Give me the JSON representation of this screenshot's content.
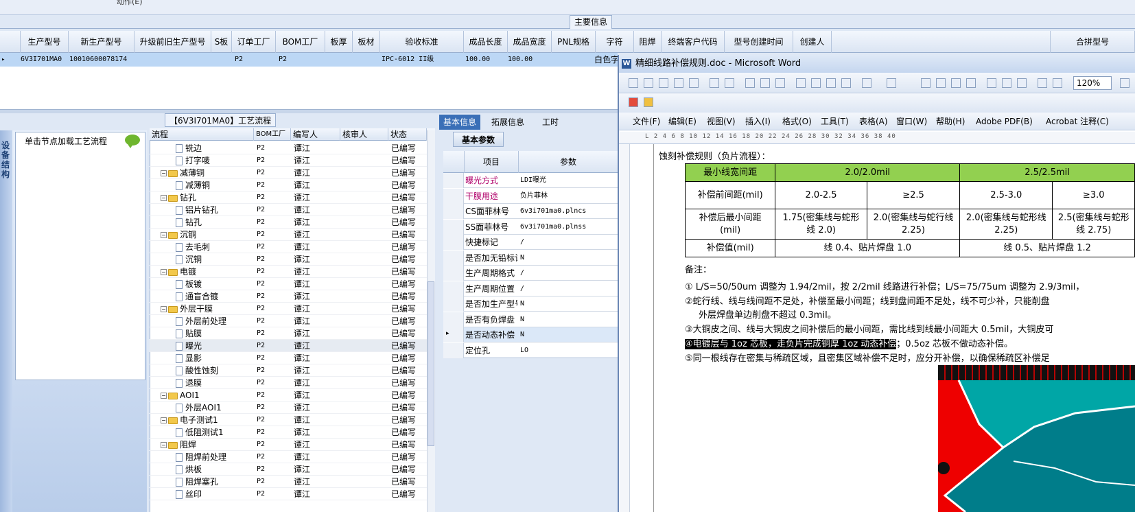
{
  "top": {
    "partial_text": "动作(E)",
    "main_info_label": "主要信息"
  },
  "grid": {
    "headers": [
      "生产型号",
      "新生产型号",
      "升级前旧生产型号",
      "S板",
      "订单工厂",
      "BOM工厂",
      "板厚",
      "板材",
      "验收标准",
      "成品长度",
      "成品宽度",
      "PNL规格",
      "字符",
      "阻焊",
      "终端客户代码",
      "型号创建时间",
      "创建人",
      "合拼型号"
    ],
    "row": {
      "prod_model": "6V3I701MA0",
      "new_model": "10010600078174",
      "order_factory": "P2",
      "bom_factory": "P2",
      "standard": "IPC-6012 II级",
      "length": "100.00",
      "width": "100.00",
      "char": "白色字"
    }
  },
  "left": {
    "vertical_label": "设备结构",
    "hint": "单击节点加载工艺流程"
  },
  "tree": {
    "title": "【6V3I701MA0】工艺流程",
    "headers": [
      "流程",
      "BOM工厂",
      "编写人",
      "核审人",
      "状态"
    ],
    "rows": [
      {
        "type": "doc",
        "name": "铣边",
        "bom": "P2",
        "author": "谭江",
        "reviewer": "",
        "status": "已编写"
      },
      {
        "type": "doc",
        "name": "打字唛",
        "bom": "P2",
        "author": "谭江",
        "reviewer": "",
        "status": "已编写"
      },
      {
        "type": "folder",
        "name": "减薄铜",
        "bom": "P2",
        "author": "谭江",
        "reviewer": "",
        "status": "已编写"
      },
      {
        "type": "doc",
        "name": "减薄铜",
        "bom": "P2",
        "author": "谭江",
        "reviewer": "",
        "status": "已编写"
      },
      {
        "type": "folder",
        "name": "钻孔",
        "bom": "P2",
        "author": "谭江",
        "reviewer": "",
        "status": "已编写"
      },
      {
        "type": "doc",
        "name": "铝片钻孔",
        "bom": "P2",
        "author": "谭江",
        "reviewer": "",
        "status": "已编写"
      },
      {
        "type": "doc",
        "name": "钻孔",
        "bom": "P2",
        "author": "谭江",
        "reviewer": "",
        "status": "已编写"
      },
      {
        "type": "folder",
        "name": "沉铜",
        "bom": "P2",
        "author": "谭江",
        "reviewer": "",
        "status": "已编写"
      },
      {
        "type": "doc",
        "name": "去毛刺",
        "bom": "P2",
        "author": "谭江",
        "reviewer": "",
        "status": "已编写"
      },
      {
        "type": "doc",
        "name": "沉铜",
        "bom": "P2",
        "author": "谭江",
        "reviewer": "",
        "status": "已编写"
      },
      {
        "type": "folder",
        "name": "电镀",
        "bom": "P2",
        "author": "谭江",
        "reviewer": "",
        "status": "已编写"
      },
      {
        "type": "doc",
        "name": "板镀",
        "bom": "P2",
        "author": "谭江",
        "reviewer": "",
        "status": "已编写"
      },
      {
        "type": "doc",
        "name": "通盲合镀",
        "bom": "P2",
        "author": "谭江",
        "reviewer": "",
        "status": "已编写"
      },
      {
        "type": "folder",
        "name": "外层干膜",
        "bom": "P2",
        "author": "谭江",
        "reviewer": "",
        "status": "已编写"
      },
      {
        "type": "doc",
        "name": "外层前处理",
        "bom": "P2",
        "author": "谭江",
        "reviewer": "",
        "status": "已编写"
      },
      {
        "type": "doc",
        "name": "贴膜",
        "bom": "P2",
        "author": "谭江",
        "reviewer": "",
        "status": "已编写"
      },
      {
        "type": "doc",
        "name": "曝光",
        "bom": "P2",
        "author": "谭江",
        "reviewer": "",
        "status": "已编写",
        "selected": true
      },
      {
        "type": "doc",
        "name": "显影",
        "bom": "P2",
        "author": "谭江",
        "reviewer": "",
        "status": "已编写"
      },
      {
        "type": "doc",
        "name": "酸性蚀刻",
        "bom": "P2",
        "author": "谭江",
        "reviewer": "",
        "status": "已编写"
      },
      {
        "type": "doc",
        "name": "退膜",
        "bom": "P2",
        "author": "谭江",
        "reviewer": "",
        "status": "已编写"
      },
      {
        "type": "folder",
        "name": "AOI1",
        "bom": "P2",
        "author": "谭江",
        "reviewer": "",
        "status": "已编写"
      },
      {
        "type": "doc",
        "name": "外层AOI1",
        "bom": "P2",
        "author": "谭江",
        "reviewer": "",
        "status": "已编写"
      },
      {
        "type": "folder",
        "name": "电子测试1",
        "bom": "P2",
        "author": "谭江",
        "reviewer": "",
        "status": "已编写"
      },
      {
        "type": "doc",
        "name": "低阻测试1",
        "bom": "P2",
        "author": "谭江",
        "reviewer": "",
        "status": "已编写"
      },
      {
        "type": "folder",
        "name": "阻焊",
        "bom": "P2",
        "author": "谭江",
        "reviewer": "",
        "status": "已编写"
      },
      {
        "type": "doc",
        "name": "阻焊前处理",
        "bom": "P2",
        "author": "谭江",
        "reviewer": "",
        "status": "已编写"
      },
      {
        "type": "doc",
        "name": "烘板",
        "bom": "P2",
        "author": "谭江",
        "reviewer": "",
        "status": "已编写"
      },
      {
        "type": "doc",
        "name": "阻焊塞孔",
        "bom": "P2",
        "author": "谭江",
        "reviewer": "",
        "status": "已编写"
      },
      {
        "type": "doc",
        "name": "丝印",
        "bom": "P2",
        "author": "谭江",
        "reviewer": "",
        "status": "已编写"
      }
    ]
  },
  "props": {
    "tabs": [
      "基本信息",
      "拓展信息",
      "工时"
    ],
    "subtab": "基本参数",
    "headers": [
      "项目",
      "参数"
    ],
    "rows": [
      {
        "k": "曝光方式",
        "v": "LDI曝光",
        "accent": true
      },
      {
        "k": "干膜用途",
        "v": "负片菲林",
        "accent": true
      },
      {
        "k": "CS面菲林号",
        "v": "6v3i701ma0.plncs"
      },
      {
        "k": "SS面菲林号",
        "v": "6v3i701ma0.plnss"
      },
      {
        "k": "快捷标记",
        "v": "/"
      },
      {
        "k": "是否加无铅标记",
        "v": "N"
      },
      {
        "k": "生产周期格式",
        "v": "/"
      },
      {
        "k": "生产周期位置",
        "v": "/"
      },
      {
        "k": "是否加生产型号",
        "v": "N"
      },
      {
        "k": "是否有负焊盘",
        "v": "N"
      },
      {
        "k": "是否动态补偿",
        "v": "N",
        "selected": true
      },
      {
        "k": "定位孔",
        "v": "LO"
      }
    ],
    "accent_color": "#b0006a"
  },
  "word": {
    "title": "精细线路补偿规则.doc - Microsoft Word",
    "zoom": "120%",
    "menus": [
      "文件(F)",
      "编辑(E)",
      "视图(V)",
      "插入(I)",
      "格式(O)",
      "工具(T)",
      "表格(A)",
      "窗口(W)",
      "帮助(H)",
      "Adobe PDF(B)",
      "Acrobat 注释(C)"
    ],
    "ruler": "L  2  4  6  8  10 12 14 16 18 20 22 24 26 28 30 32 34 36 38 40",
    "heading": "蚀刻补偿规则（负片流程）：",
    "table": {
      "r1": [
        "最小线宽间距",
        "2.0/2.0mil",
        "2.5/2.5mil"
      ],
      "r2": [
        "补偿前间距(mil)",
        "2.0-2.5",
        "≥2.5",
        "2.5-3.0",
        "≥3.0"
      ],
      "r3": [
        "补偿后最小间距(mil)",
        "1.75(密集线与蛇形线 2.0)",
        "2.0(密集线与蛇行线 2.25)",
        "2.0(密集线与蛇形线 2.25)",
        "2.5(密集线与蛇形线 2.75)"
      ],
      "r4": [
        "补偿值(mil)",
        "线 0.4、贴片焊盘 1.0",
        "线 0.5、贴片焊盘 1.2"
      ]
    },
    "note_label": "备注：",
    "notes": {
      "n1": "① L/S=50/50um 调整为 1.94/2mil，按 2/2mil 线路进行补偿；L/S=75/75um 调整为 2.9/3mil，",
      "n2": "②蛇行线、线与线间距不足处，补偿至最小间距；线到盘间距不足处，线不可少补，只能削盘",
      "n2b": "外层焊盘单边削盘不超过 0.3mil。",
      "n3": "③大铜皮之间、线与大铜皮之间补偿后的最小间距，需比线到线最小间距大 0.5mil，大铜皮可",
      "n4_hl": "④电镀层与 1oz 芯板，走负片完成铜厚 1oz 动态补偿",
      "n4_rest": "；0.5oz 芯板不做动态补偿。",
      "n5": "⑤同一根线存在密集与稀疏区域，且密集区域补偿不足时，应分开补偿，以确保稀疏区补偿足"
    }
  }
}
